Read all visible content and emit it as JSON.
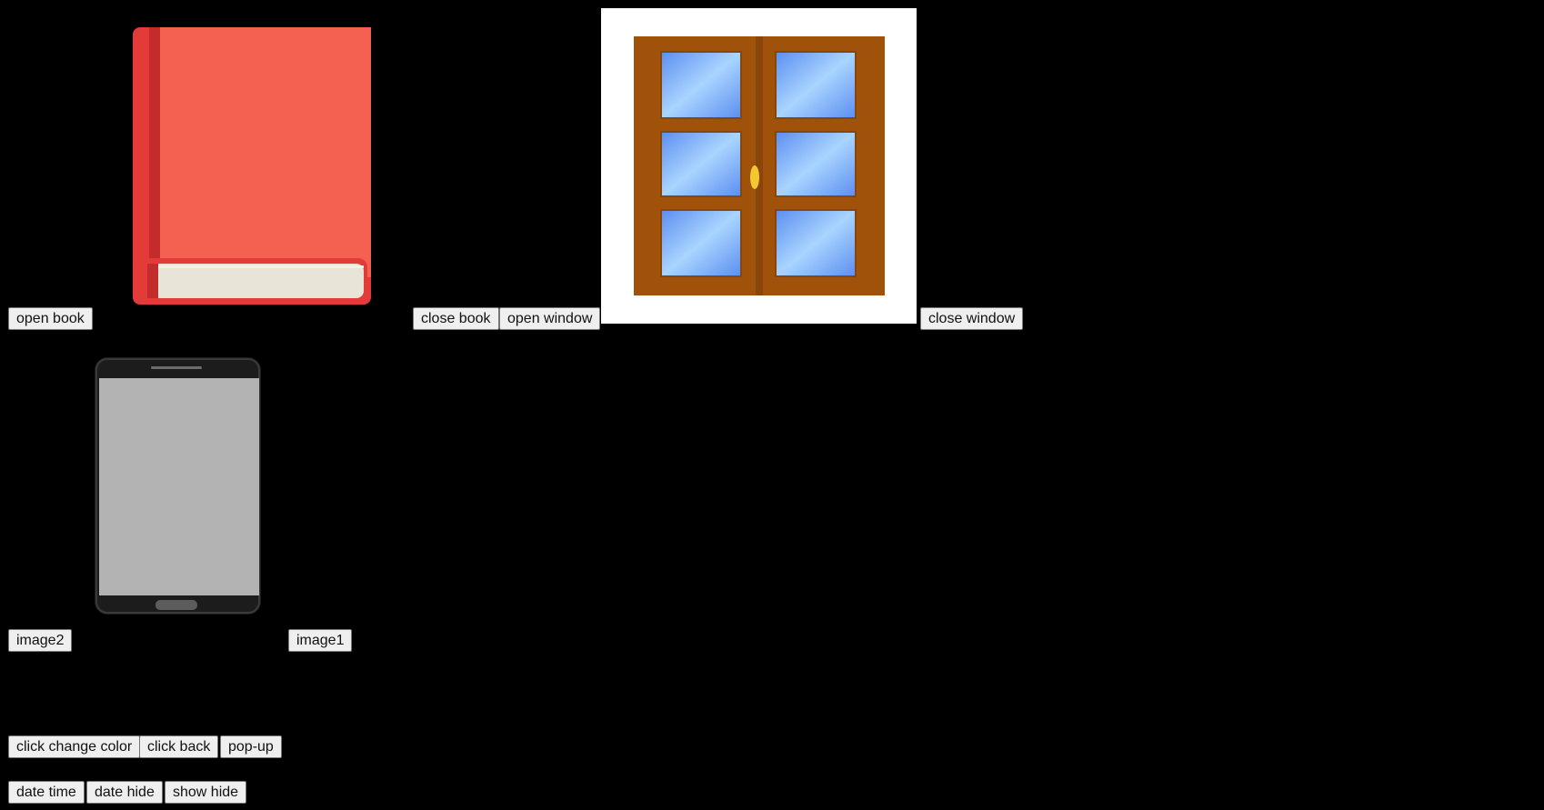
{
  "buttons": {
    "open_book": "open book",
    "close_book": "close book",
    "open_window": "open window",
    "close_window": "close window",
    "image2": "image2",
    "image1": "image1",
    "click_change_color": "click change color",
    "click_back": "click back",
    "pop_up": "pop-up",
    "date_time": "date time",
    "date_hide": "date hide",
    "show_hide": "show hide"
  },
  "images": {
    "book": "closed-book-icon",
    "window": "closed-window-icon",
    "phone": "smartphone-icon"
  },
  "colors": {
    "background": "#000000",
    "book_cover": "#f56150",
    "book_spine": "#e23b39",
    "book_pages": "#e8e4d8",
    "window_frame": "#a0520a",
    "window_glass": "#6ea8f0",
    "window_handle": "#f2c830",
    "phone_body": "#1c1c1c",
    "phone_screen": "#b3b3b3"
  }
}
